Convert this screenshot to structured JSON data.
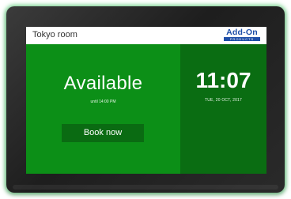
{
  "header": {
    "room_name": "Tokyo room",
    "logo_text": "Add-On",
    "logo_subtext": "PRODUCTS"
  },
  "booking": {
    "status": "Available",
    "until": "until 14:00 PM",
    "book_button": "Book now"
  },
  "clock": {
    "time": "11:07",
    "date": "TUE, 20 OCT, 2017"
  },
  "colors": {
    "available_green": "#0c8f17",
    "clock_panel_green": "#0a6d12",
    "logo_blue": "#1f4fa8"
  }
}
